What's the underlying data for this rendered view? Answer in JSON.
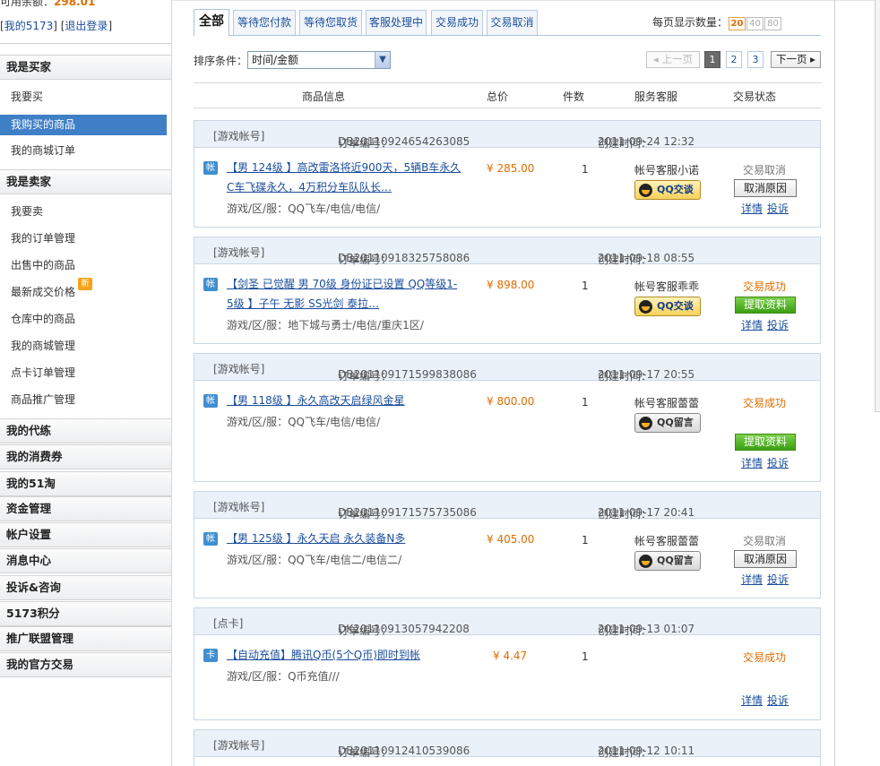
{
  "sidebar": {
    "balance_label": "可用余额：",
    "balance_value": "298.01",
    "my_link": "我的5173",
    "logout_link": "退出登录",
    "buyer_title": "我是买家",
    "buyer_items": [
      "我要买",
      "我购买的商品",
      "我的商城订单"
    ],
    "seller_title": "我是卖家",
    "seller_items": [
      "我要卖",
      "我的订单管理",
      "出售中的商品",
      "最新成交价格",
      "仓库中的商品",
      "我的商城管理",
      "点卡订单管理",
      "商品推广管理"
    ],
    "new_badge": "新",
    "groups": [
      "我的代练",
      "我的消费券",
      "我的51淘",
      "资金管理",
      "帐户设置",
      "消息中心",
      "投诉&咨询",
      "5173积分",
      "推广联盟管理",
      "我的官方交易"
    ]
  },
  "tabs": [
    "全部",
    "等待您付款",
    "等待您取货",
    "客服处理中",
    "交易成功",
    "交易取消"
  ],
  "perpage": {
    "label": "每页显示数量：",
    "options": [
      "20",
      "40",
      "80"
    ],
    "selected": "20"
  },
  "sort": {
    "label": "排序条件：",
    "value": "时间/金额"
  },
  "pager": {
    "prev": "上一页",
    "pages": [
      "1",
      "2",
      "3"
    ],
    "current": "1",
    "next": "下一页"
  },
  "columns": {
    "info": "商品信息",
    "total": "总价",
    "qty": "件数",
    "service": "服务客服",
    "status": "交易状态"
  },
  "labels": {
    "order_no": "订单编号：",
    "created": "创建时间：",
    "region": "游戏/区/服：",
    "qq_chat": "QQ交谈",
    "qq_msg": "QQ留言",
    "cancel_reason": "取消原因",
    "fetch_info": "提取资料",
    "detail": "详情",
    "complain": "投诉"
  },
  "orders": [
    {
      "type": "[游戏帐号]",
      "no": "DB20110924654263085",
      "time": "2011-09-24 12:32",
      "icon": "帐",
      "title1": "【男 124级 】高改雷洛将近900天，5辆B车永久",
      "title2": "C车飞碟永久，4万积分车队队长…",
      "region": "QQ飞车/电信/电信/",
      "price": "¥ 285.00",
      "qty": "1",
      "service": "帐号客服小诺",
      "status": "交易取消"
    },
    {
      "type": "[游戏帐号]",
      "no": "DB20110918325758086",
      "time": "2011-09-18 08:55",
      "icon": "帐",
      "title1": "【剑圣 已觉醒 男 70级 身份证已设置 QQ等级1-",
      "title2": "5级 】子午 无影 SS光剑 泰拉…",
      "region": "地下城与勇士/电信/重庆1区/",
      "price": "¥ 898.00",
      "qty": "1",
      "service": "帐号客服乖乖",
      "status": "交易成功"
    },
    {
      "type": "[游戏帐号]",
      "no": "DB201109171599838086",
      "time": "2011-09-17 20:55",
      "icon": "帐",
      "title1": "【男 118级 】永久高改天启绿风金星",
      "title2": "",
      "region": "QQ飞车/电信/电信/",
      "price": "¥ 800.00",
      "qty": "1",
      "service": "帐号客服蕾蕾",
      "status": "交易成功"
    },
    {
      "type": "[游戏帐号]",
      "no": "DB20110917157573508б",
      "time": "2011-09-17 20:41",
      "icon": "帐",
      "title1": "【男 125级 】永久天启 永久装备N多",
      "title2": "",
      "region": "QQ飞车/电信二/电信二/",
      "price": "¥ 405.00",
      "qty": "1",
      "service": "帐号客服蕾蕾",
      "status": "交易取消"
    },
    {
      "type": "[点卡]",
      "no": "DK20110913057942208",
      "time": "2011-09-13 01:07",
      "icon": "卡",
      "title1": "【自动充值】腾讯Q币(5个Q币)即时到帐",
      "title2": "",
      "region": "Q币充值///",
      "price": "¥ 4.47",
      "qty": "1",
      "service": "",
      "status": "交易成功"
    },
    {
      "type": "[游戏帐号]",
      "no": "DB20110912410539086",
      "time": "2011-09-12 10:11"
    }
  ]
}
